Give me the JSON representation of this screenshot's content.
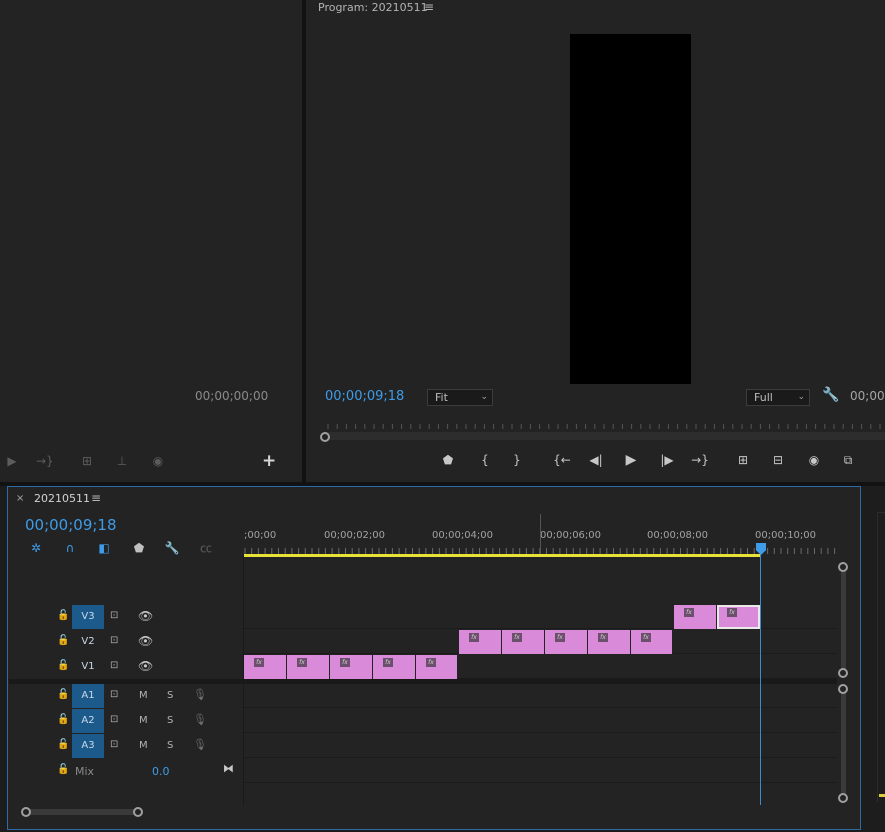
{
  "source": {
    "timecode": "00;00;00;00",
    "add_label": "+",
    "controls": [
      "mark-in-icon",
      "go-to-out-icon",
      "insert-icon",
      "overwrite-icon",
      "export-frame-icon"
    ]
  },
  "program": {
    "title": "Program: 20210511",
    "menu_glyph": "≡",
    "timecode": "00;00;09;18",
    "zoom": "Fit",
    "resolution": "Full",
    "duration_timecode": "00;00",
    "controls": [
      {
        "name": "add-marker-button",
        "glyph": "⬟"
      },
      {
        "name": "mark-in-button",
        "glyph": "{"
      },
      {
        "name": "mark-out-button",
        "glyph": "}"
      },
      {
        "name": "go-to-in-button",
        "glyph": "{←"
      },
      {
        "name": "step-back-button",
        "glyph": "◀|"
      },
      {
        "name": "play-button",
        "glyph": "▶"
      },
      {
        "name": "step-forward-button",
        "glyph": "|▶"
      },
      {
        "name": "go-to-out-button",
        "glyph": "→}"
      },
      {
        "name": "lift-button",
        "glyph": "⊞"
      },
      {
        "name": "extract-button",
        "glyph": "⊟"
      },
      {
        "name": "export-frame-button",
        "glyph": "◉"
      },
      {
        "name": "comparison-view-button",
        "glyph": "⧉"
      }
    ]
  },
  "timeline": {
    "close_glyph": "×",
    "title": "20210511",
    "menu_glyph": "≡",
    "timecode": "00;00;09;18",
    "ruler": [
      ";00;00",
      "00;00;02;00",
      "00;00;04;00",
      "00;00;06;00",
      "00;00;08;00",
      "00;00;10;00"
    ],
    "video_tracks": [
      {
        "name": "V3",
        "active": true
      },
      {
        "name": "V2",
        "active": false
      },
      {
        "name": "V1",
        "active": false
      }
    ],
    "audio_tracks": [
      {
        "name": "A1",
        "mute": "M",
        "solo": "S"
      },
      {
        "name": "A2",
        "mute": "M",
        "solo": "S"
      },
      {
        "name": "A3",
        "mute": "M",
        "solo": "S"
      }
    ],
    "mix": {
      "label": "Mix",
      "value": "0.0"
    },
    "clip_label": "fx",
    "colors": {
      "clip": "#d98ad8",
      "accent": "#3e9ce8",
      "work_area": "#e6e23a"
    }
  }
}
